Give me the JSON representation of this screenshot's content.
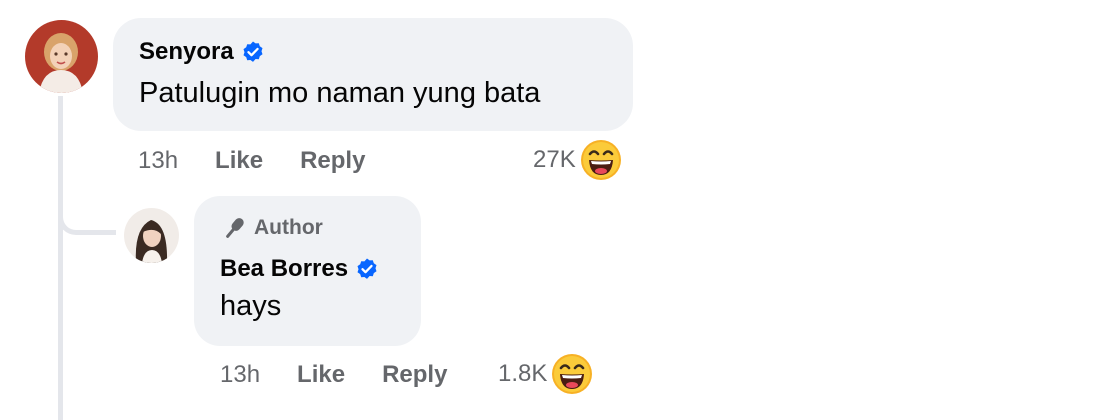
{
  "comments": [
    {
      "author": "Senyora",
      "verified": true,
      "text": "Patulugin mo naman yung bata",
      "time": "13h",
      "like_label": "Like",
      "reply_label": "Reply",
      "reaction_count": "27K",
      "reaction_icon": "laughing-emoji-icon"
    }
  ],
  "reply": {
    "badge": "Author",
    "badge_icon": "microphone-icon",
    "author": "Bea Borres",
    "verified": true,
    "text": "hays",
    "time": "13h",
    "like_label": "Like",
    "reply_label": "Reply",
    "reaction_count": "1.8K",
    "reaction_icon": "laughing-emoji-icon"
  },
  "colors": {
    "verified_blue": "#0866ff",
    "bubble_bg": "#f0f2f5",
    "secondary_text": "#65676b",
    "thread_line": "#e4e6eb"
  }
}
